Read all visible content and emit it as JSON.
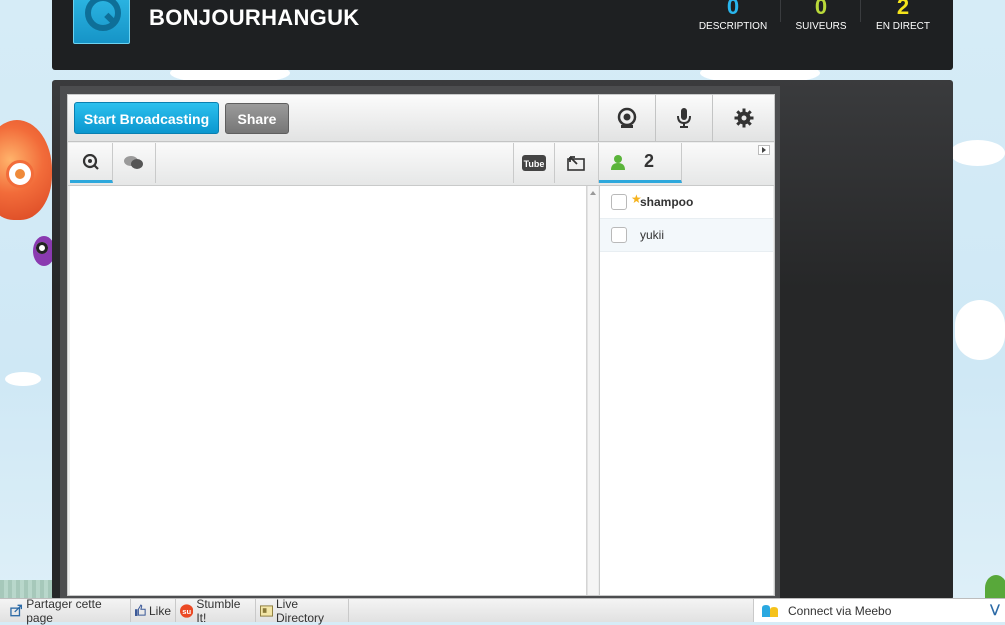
{
  "header": {
    "channel_name": "BONJOURHANGUK",
    "stats": [
      {
        "value": "0",
        "label": "DESCRIPTION",
        "color": "#29b6ee"
      },
      {
        "value": "0",
        "label": "SUIVEURS",
        "color": "#b9d83a"
      },
      {
        "value": "2",
        "label": "EN DIRECT",
        "color": "#f5e41b"
      }
    ]
  },
  "toolbar": {
    "start_label": "Start Broadcasting",
    "share_label": "Share"
  },
  "users_tab": {
    "count": "2"
  },
  "users": [
    {
      "name": "shampoo",
      "moderator": true
    },
    {
      "name": "yukii",
      "moderator": false
    }
  ],
  "bottombar": {
    "share_page": "Partager cette page",
    "like": "Like",
    "stumble": "Stumble It!",
    "live_directory": "Live Directory",
    "meebo": "Connect via Meebo"
  },
  "colors": {
    "accent": "#1aa8dc",
    "header_bg": "#1e2022"
  }
}
